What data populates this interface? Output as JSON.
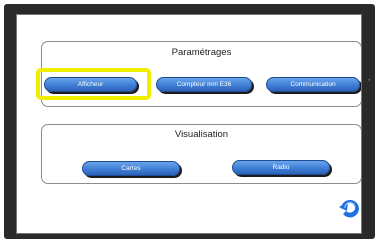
{
  "parametrages": {
    "title": "Paramétrages",
    "buttons": [
      "Afficheur",
      "Compteur mm E36",
      "Communication"
    ]
  },
  "visualisation": {
    "title": "Visualisation",
    "buttons": [
      "Cartes",
      "Radio"
    ]
  },
  "side_mark": "*",
  "colors": {
    "button_blue": "#3f7fd6",
    "highlight": "#f2ee00",
    "frame": "#2a2a2a"
  },
  "icons": {
    "back": "back-arrow-icon"
  }
}
